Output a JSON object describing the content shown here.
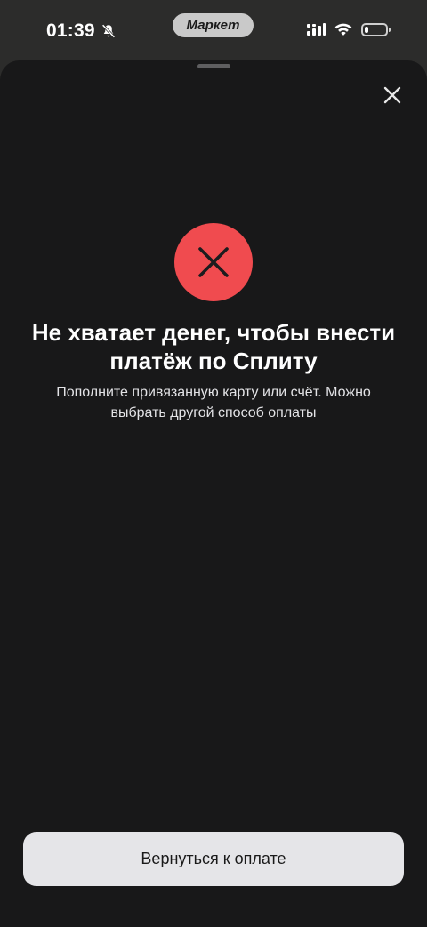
{
  "status_bar": {
    "time": "01:39",
    "app_name": "Маркет",
    "icons": [
      "bell-off-icon",
      "signal-icon",
      "wifi-icon",
      "battery-icon"
    ],
    "battery_level_fraction": 0.2
  },
  "sheet": {
    "title": "Не хватает денег, чтобы внести платёж по Сплиту",
    "subtitle": "Пополните привязанную карту или счёт. Можно выбрать другой способ оплаты",
    "close_icon": "close-icon",
    "status_icon": "error-x-icon",
    "primary_button_label": "Вернуться к оплате"
  },
  "colors": {
    "background": "#2c2c2b",
    "sheet": "#181819",
    "error_accent": "#f04b4f",
    "button_bg": "#e5e5e8",
    "button_text": "#1a1a1a",
    "text_primary": "#ffffff"
  }
}
